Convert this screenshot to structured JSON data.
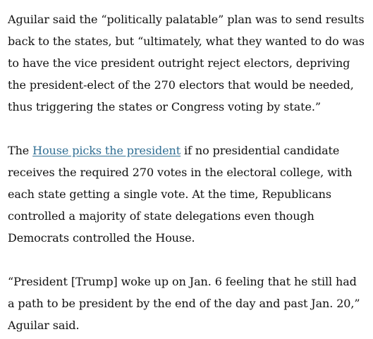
{
  "article": {
    "paragraphs": [
      {
        "text": "Aguilar said the “politically palatable” plan was to send results back to the states, but “ultimately, what they wanted to do was to have the vice president outright reject electors, depriving the president-elect of the 270 electors that would be needed, thus triggering the states or Congress voting by state.”"
      },
      {
        "before": "The ",
        "link_text": "House picks the president",
        "after": " if no presidential candidate receives the required 270 votes in the electoral college, with each state getting a single vote. At the time, Republicans controlled a majority of state delegations even though Democrats controlled the House."
      },
      {
        "text": "“President [Trump] woke up on Jan. 6 feeling that he still had a path to be president by the end of the day and past Jan. 20,” Aguilar said."
      }
    ],
    "link_color": "#2f6e93"
  }
}
